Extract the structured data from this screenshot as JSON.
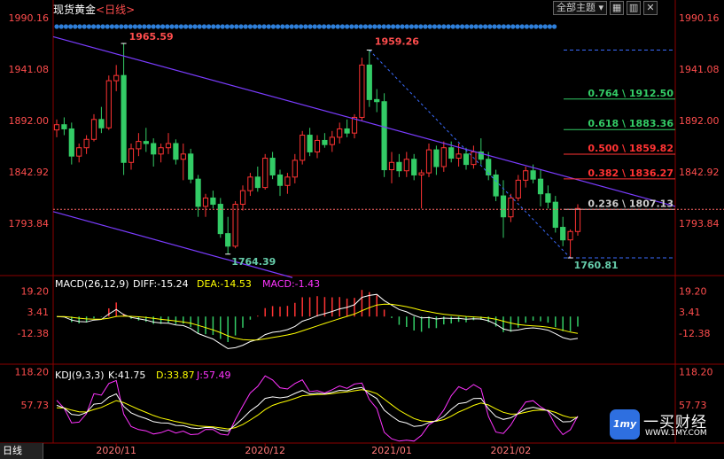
{
  "header": {
    "symbol": "现货黄金",
    "period": "<日线>",
    "theme_button": "全部主题",
    "window_icons": [
      "dropdown-icon",
      "grid-icon",
      "layout-icon",
      "close-icon"
    ]
  },
  "colors": {
    "up": "#ff3333",
    "down": "#33cc66",
    "axis_red": "#ff4d4d",
    "trendline": "#7a3cff",
    "fib_blue": "#3b6cff",
    "ema_white": "#ffffff",
    "ema_yellow": "#ffff00",
    "kdj_j": "#ff33ff",
    "dots": "#2f7fd9"
  },
  "chart_data": [
    {
      "type": "candlestick",
      "panel": "main",
      "yaxis_labels": [
        "1990.16",
        "1941.08",
        "1892.00",
        "1842.92",
        "1793.84"
      ],
      "xaxis_labels": [
        "2020/11",
        "2020/12",
        "2021/01",
        "2021/02"
      ],
      "highlights": [
        {
          "label": "1965.59",
          "value": 1965.59,
          "kind": "high"
        },
        {
          "label": "1764.39",
          "value": 1764.39,
          "kind": "low"
        },
        {
          "label": "1959.26",
          "value": 1959.26,
          "kind": "high"
        },
        {
          "label": "1760.81",
          "value": 1760.81,
          "kind": "low"
        }
      ],
      "fibonacci": [
        {
          "label": "0.764 \\ 1912.50",
          "ratio": 0.764,
          "value": 1912.5,
          "color": "#33cc66"
        },
        {
          "label": "0.618 \\ 1883.36",
          "ratio": 0.618,
          "value": 1883.36,
          "color": "#33cc66"
        },
        {
          "label": "0.500 \\ 1859.82",
          "ratio": 0.5,
          "value": 1859.82,
          "color": "#ff3333"
        },
        {
          "label": "0.382 \\ 1836.27",
          "ratio": 0.382,
          "value": 1836.27,
          "color": "#ff3333"
        },
        {
          "label": "0.236 \\ 1807.13",
          "ratio": 0.236,
          "value": 1807.13,
          "color": "#cccccc"
        }
      ],
      "current_price_line": 1807.13,
      "candles": [
        [
          1883,
          1893,
          1876,
          1888
        ],
        [
          1888,
          1895,
          1878,
          1884
        ],
        [
          1884,
          1890,
          1850,
          1858
        ],
        [
          1858,
          1870,
          1852,
          1866
        ],
        [
          1866,
          1878,
          1860,
          1874
        ],
        [
          1874,
          1898,
          1872,
          1893
        ],
        [
          1893,
          1905,
          1880,
          1885
        ],
        [
          1885,
          1935,
          1883,
          1930
        ],
        [
          1930,
          1945,
          1920,
          1935
        ],
        [
          1935,
          1965.59,
          1840,
          1852
        ],
        [
          1852,
          1870,
          1845,
          1865
        ],
        [
          1865,
          1880,
          1858,
          1872
        ],
        [
          1872,
          1885,
          1862,
          1870
        ],
        [
          1870,
          1875,
          1848,
          1860
        ],
        [
          1860,
          1870,
          1852,
          1866
        ],
        [
          1866,
          1880,
          1860,
          1870
        ],
        [
          1870,
          1874,
          1850,
          1855
        ],
        [
          1855,
          1870,
          1835,
          1860
        ],
        [
          1860,
          1865,
          1832,
          1836
        ],
        [
          1836,
          1840,
          1800,
          1810
        ],
        [
          1810,
          1822,
          1800,
          1818
        ],
        [
          1818,
          1825,
          1808,
          1812
        ],
        [
          1812,
          1818,
          1780,
          1784
        ],
        [
          1784,
          1800,
          1764.39,
          1772
        ],
        [
          1772,
          1815,
          1770,
          1812
        ],
        [
          1812,
          1830,
          1806,
          1825
        ],
        [
          1825,
          1842,
          1820,
          1838
        ],
        [
          1838,
          1848,
          1824,
          1828
        ],
        [
          1828,
          1860,
          1826,
          1856
        ],
        [
          1856,
          1862,
          1836,
          1840
        ],
        [
          1840,
          1845,
          1820,
          1830
        ],
        [
          1830,
          1842,
          1822,
          1838
        ],
        [
          1838,
          1860,
          1832,
          1854
        ],
        [
          1854,
          1882,
          1850,
          1878
        ],
        [
          1878,
          1885,
          1858,
          1862
        ],
        [
          1862,
          1878,
          1856,
          1873
        ],
        [
          1873,
          1880,
          1866,
          1869
        ],
        [
          1869,
          1882,
          1862,
          1876
        ],
        [
          1876,
          1890,
          1870,
          1884
        ],
        [
          1884,
          1893,
          1876,
          1880
        ],
        [
          1880,
          1898,
          1875,
          1895
        ],
        [
          1895,
          1952,
          1892,
          1945
        ],
        [
          1945,
          1959.26,
          1905,
          1912
        ],
        [
          1912,
          1922,
          1900,
          1910
        ],
        [
          1910,
          1918,
          1838,
          1845
        ],
        [
          1845,
          1862,
          1832,
          1852
        ],
        [
          1852,
          1860,
          1838,
          1844
        ],
        [
          1844,
          1862,
          1838,
          1855
        ],
        [
          1855,
          1860,
          1835,
          1840
        ],
        [
          1840,
          1845,
          1808,
          1842
        ],
        [
          1842,
          1870,
          1838,
          1864
        ],
        [
          1864,
          1868,
          1840,
          1848
        ],
        [
          1848,
          1872,
          1843,
          1866
        ],
        [
          1866,
          1872,
          1852,
          1856
        ],
        [
          1856,
          1870,
          1848,
          1860
        ],
        [
          1860,
          1866,
          1845,
          1850
        ],
        [
          1850,
          1868,
          1846,
          1862
        ],
        [
          1862,
          1875,
          1850,
          1855
        ],
        [
          1855,
          1862,
          1835,
          1840
        ],
        [
          1840,
          1845,
          1815,
          1820
        ],
        [
          1820,
          1835,
          1780,
          1800
        ],
        [
          1800,
          1822,
          1795,
          1818
        ],
        [
          1818,
          1840,
          1815,
          1835
        ],
        [
          1835,
          1848,
          1828,
          1844
        ],
        [
          1844,
          1850,
          1832,
          1836
        ],
        [
          1836,
          1845,
          1810,
          1822
        ],
        [
          1822,
          1830,
          1808,
          1814
        ],
        [
          1814,
          1820,
          1785,
          1790
        ],
        [
          1790,
          1800,
          1772,
          1778
        ],
        [
          1778,
          1788,
          1760.81,
          1786
        ],
        [
          1786,
          1812,
          1782,
          1808
        ]
      ]
    },
    {
      "type": "macd",
      "panel": "macd",
      "title": "MACD(26,12,9)",
      "values": {
        "DIFF": "DIFF:-15.24",
        "DEA": "DEA:-14.53",
        "MACD": "MACD:-1.43"
      },
      "yaxis_labels": [
        "19.20",
        "3.41",
        "-12.38"
      ]
    },
    {
      "type": "kdj",
      "panel": "kdj",
      "title": "KDJ(9,3,3)",
      "values": {
        "K": "K:41.75",
        "D": "D:33.87",
        "J": "J:57.49"
      },
      "yaxis_labels": [
        "118.20",
        "57.73"
      ]
    }
  ],
  "watermark": {
    "brand": "一买财经",
    "url": "WWW.1MY.COM",
    "badge": "1my"
  },
  "bottom_tab": "日线"
}
